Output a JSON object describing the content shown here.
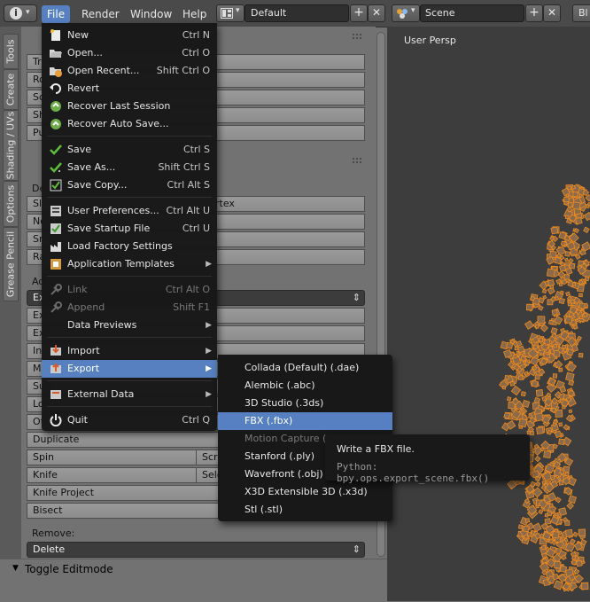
{
  "topbar": {
    "menus": [
      "File",
      "Render",
      "Window",
      "Help"
    ],
    "layout_name": "Default",
    "scene_name": "Scene",
    "add_icon": "plus-icon",
    "close_icon": "x-icon",
    "right_btn": "Bl"
  },
  "tabs": [
    "Tools",
    "Create",
    "Shading / UVs",
    "Options",
    "Grease Pencil"
  ],
  "toolpanel": {
    "tool_fragments": [
      "Tr",
      "Ro",
      "Sc",
      "Sh",
      "Pu"
    ],
    "deform_fragments": [
      "De",
      "Sl",
      "No",
      "Sr",
      "Ra"
    ],
    "vertex_fragment": "rtex",
    "add_fragment": "Ad",
    "extrude_fragments": [
      "Ex",
      "Extr",
      "Extr"
    ],
    "fragment_in": "In",
    "fragment_m": "M",
    "fragment_su": "Sub",
    "fragment_lo": "Loo",
    "fragment_of": "Off",
    "duplicate": "Duplicate",
    "spin": "Spin",
    "screw": "Screw",
    "knife": "Knife",
    "select": "Select",
    "knife_project": "Knife Project",
    "bisect": "Bisect",
    "remove_label": "Remove:",
    "delete": "Delete",
    "toggle_editmode": "Toggle Editmode"
  },
  "viewport": {
    "label": "User Persp"
  },
  "filemenu": {
    "items": [
      {
        "label": "New",
        "shortcut": "Ctrl N",
        "icon": "new-file-icon"
      },
      {
        "label": "Open...",
        "shortcut": "Ctrl O",
        "icon": "folder-open-icon"
      },
      {
        "label": "Open Recent...",
        "shortcut": "Shift Ctrl O",
        "icon": "recent-icon"
      },
      {
        "label": "Revert",
        "shortcut": "",
        "icon": "revert-icon"
      },
      {
        "label": "Recover Last Session",
        "shortcut": "",
        "icon": "recover-icon"
      },
      {
        "label": "Recover Auto Save...",
        "shortcut": "",
        "icon": "recover-auto-icon"
      },
      {
        "label": "Save",
        "shortcut": "Ctrl S",
        "icon": "checkmark-icon"
      },
      {
        "label": "Save As...",
        "shortcut": "Shift Ctrl S",
        "icon": "save-as-icon"
      },
      {
        "label": "Save Copy...",
        "shortcut": "Ctrl Alt S",
        "icon": "save-copy-icon"
      },
      {
        "label": "User Preferences...",
        "shortcut": "Ctrl Alt U",
        "icon": "preferences-icon"
      },
      {
        "label": "Save Startup File",
        "shortcut": "Ctrl U",
        "icon": "save-startup-icon"
      },
      {
        "label": "Load Factory Settings",
        "shortcut": "",
        "icon": "factory-icon"
      },
      {
        "label": "Application Templates",
        "shortcut": "",
        "icon": "templates-icon"
      },
      {
        "label": "Link",
        "shortcut": "Ctrl Alt O",
        "icon": "link-icon"
      },
      {
        "label": "Append",
        "shortcut": "Shift F1",
        "icon": "append-icon"
      },
      {
        "label": "Data Previews",
        "shortcut": "",
        "icon": ""
      },
      {
        "label": "Import",
        "shortcut": "",
        "icon": "import-icon"
      },
      {
        "label": "Export",
        "shortcut": "",
        "icon": "export-icon"
      },
      {
        "label": "External Data",
        "shortcut": "",
        "icon": "external-data-icon"
      },
      {
        "label": "Quit",
        "shortcut": "Ctrl Q",
        "icon": "power-icon"
      }
    ]
  },
  "exportmenu": {
    "items": [
      "Collada (Default) (.dae)",
      "Alembic (.abc)",
      "3D Studio (.3ds)",
      "FBX (.fbx)",
      "Motion Capture (.b",
      "Stanford (.ply)",
      "Wavefront (.obj)",
      "X3D Extensible 3D (.x3d)",
      "Stl (.stl)"
    ]
  },
  "tooltip": {
    "title": "Write a FBX file.",
    "python": "Python: bpy.ops.export_scene.fbx()"
  },
  "colors": {
    "accent": "#5680c2",
    "menu_bg": "#181818",
    "mesh_orange": "#f08a1c"
  }
}
